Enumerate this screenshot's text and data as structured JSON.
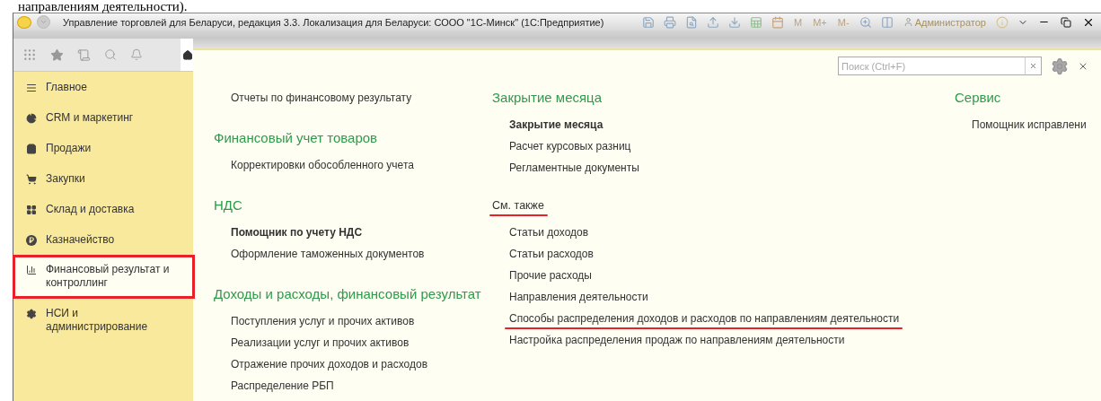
{
  "caption_above": "направлениям деятельности).",
  "window": {
    "title": "Управление торговлей для Беларуси, редакция 3.3. Локализация для Беларуси: СООО \"1С-Минск\"  (1С:Предприятие)",
    "memory_buttons": [
      "M",
      "M+",
      "M-"
    ],
    "user": "Администратор"
  },
  "sidebar": {
    "items": [
      {
        "label": "Главное",
        "selected": false,
        "annotated": false
      },
      {
        "label": "CRM и маркетинг",
        "selected": false,
        "annotated": false
      },
      {
        "label": "Продажи",
        "selected": false,
        "annotated": false
      },
      {
        "label": "Закупки",
        "selected": false,
        "annotated": false
      },
      {
        "label": "Склад и доставка",
        "selected": false,
        "annotated": false
      },
      {
        "label": "Казначейство",
        "selected": false,
        "annotated": false
      },
      {
        "label": "Финансовый результат и контроллинг",
        "selected": true,
        "annotated": true
      },
      {
        "label": "НСИ и администрирование",
        "selected": false,
        "annotated": false
      }
    ]
  },
  "search": {
    "placeholder": "Поиск (Ctrl+F)"
  },
  "columns": [
    [
      {
        "kind": "link",
        "text": "Отчеты по финансовому результату",
        "bold": false,
        "annotated": false
      },
      {
        "kind": "heading",
        "text": "Финансовый учет товаров"
      },
      {
        "kind": "link",
        "text": "Корректировки обособленного учета",
        "bold": false,
        "annotated": false
      },
      {
        "kind": "heading",
        "text": "НДС"
      },
      {
        "kind": "link",
        "text": "Помощник по учету НДС",
        "bold": true,
        "annotated": false
      },
      {
        "kind": "link",
        "text": "Оформление таможенных документов",
        "bold": false,
        "annotated": false
      },
      {
        "kind": "heading",
        "text": "Доходы и расходы, финансовый результат"
      },
      {
        "kind": "link",
        "text": "Поступления услуг и прочих активов",
        "bold": false,
        "annotated": false
      },
      {
        "kind": "link",
        "text": "Реализации услуг и прочих активов",
        "bold": false,
        "annotated": false
      },
      {
        "kind": "link",
        "text": "Отражение прочих доходов и расходов",
        "bold": false,
        "annotated": false
      },
      {
        "kind": "link",
        "text": "Распределение РБП",
        "bold": false,
        "annotated": false
      }
    ],
    [
      {
        "kind": "heading",
        "text": "Закрытие месяца"
      },
      {
        "kind": "link",
        "text": "Закрытие месяца",
        "bold": true,
        "annotated": false
      },
      {
        "kind": "link",
        "text": "Расчет курсовых разниц",
        "bold": false,
        "annotated": false
      },
      {
        "kind": "link",
        "text": "Регламентные документы",
        "bold": false,
        "annotated": false
      },
      {
        "kind": "subheading",
        "text": "См. также",
        "bold": false,
        "annotated": true
      },
      {
        "kind": "link",
        "text": "Статьи доходов",
        "bold": false,
        "annotated": false
      },
      {
        "kind": "link",
        "text": "Статьи расходов",
        "bold": false,
        "annotated": false
      },
      {
        "kind": "link",
        "text": "Прочие расходы",
        "bold": false,
        "annotated": false
      },
      {
        "kind": "link",
        "text": "Направления деятельности",
        "bold": false,
        "annotated": false
      },
      {
        "kind": "link",
        "text": "Способы распределения доходов и расходов по направлениям деятельности",
        "bold": false,
        "annotated": true
      },
      {
        "kind": "link",
        "text": "Настройка распределения продаж по направлениям деятельности",
        "bold": false,
        "annotated": false
      }
    ],
    [
      {
        "kind": "heading",
        "text": "Сервис"
      },
      {
        "kind": "link",
        "text": "Помощник исправлени",
        "bold": false,
        "annotated": false
      }
    ]
  ]
}
